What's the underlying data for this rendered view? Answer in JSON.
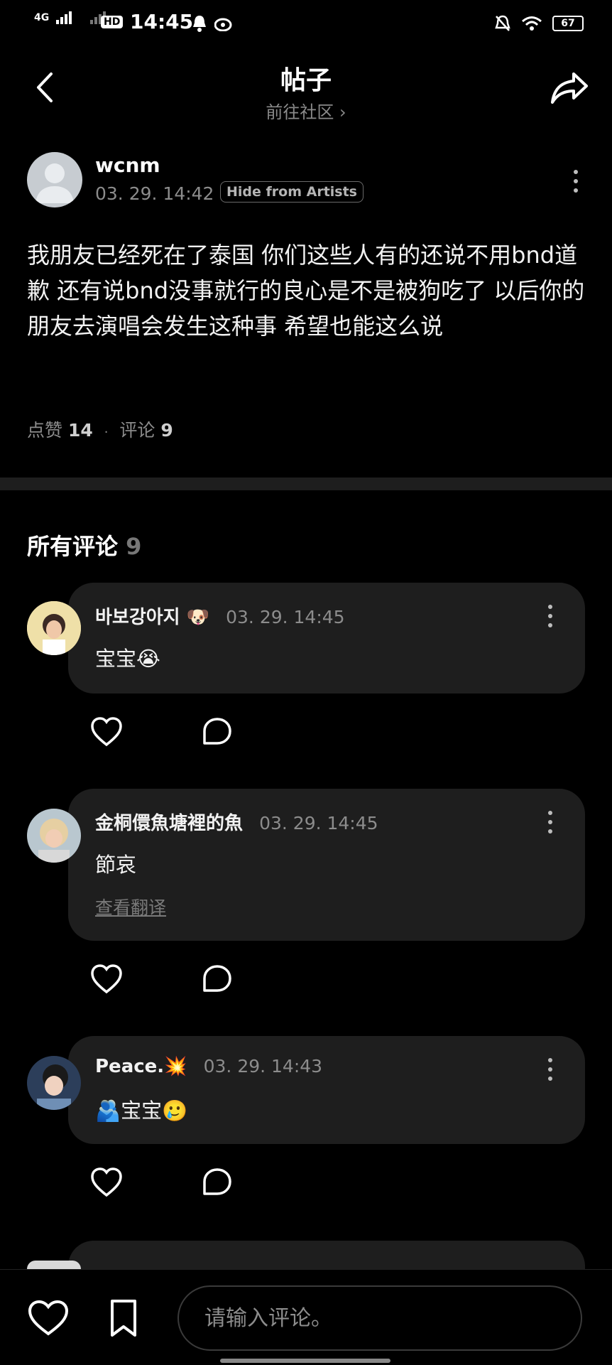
{
  "status_bar": {
    "network_left": "4G",
    "time": "14:45",
    "hd_badge": "HD",
    "battery": "67"
  },
  "header": {
    "title": "帖子",
    "community_link": "前往社区 ›"
  },
  "post": {
    "author": "wcnm",
    "timestamp": "03. 29. 14:42",
    "badge": "Hide from Artists",
    "body": "我朋友已经死在了泰国 你们这些人有的还说不用bnd道歉 还有说bnd没事就行的良心是不是被狗吃了 以后你的朋友去演唱会发生这种事 希望也能这么说",
    "likes_label": "点赞",
    "likes_count": "14",
    "separator": "·",
    "comments_label": "评论",
    "comments_count": "9"
  },
  "comments_section": {
    "heading": "所有评论",
    "count": "9",
    "items": [
      {
        "author": "바보강아지",
        "author_emoji": "🐶",
        "timestamp": "03. 29. 14:45",
        "text": "宝宝😭"
      },
      {
        "author": "金桐儇魚塘裡的魚",
        "timestamp": "03. 29. 14:45",
        "text": "節哀",
        "translate": "查看翻译"
      },
      {
        "author": "Peace.",
        "author_emoji": "💥",
        "timestamp": "03. 29. 14:43",
        "text": "🫂宝宝🥲"
      }
    ]
  },
  "bottom_bar": {
    "input_placeholder": "请输入评论。"
  },
  "colors": {
    "background": "#000000",
    "card": "#1e1e1e",
    "muted_text": "#8c8c8c"
  }
}
